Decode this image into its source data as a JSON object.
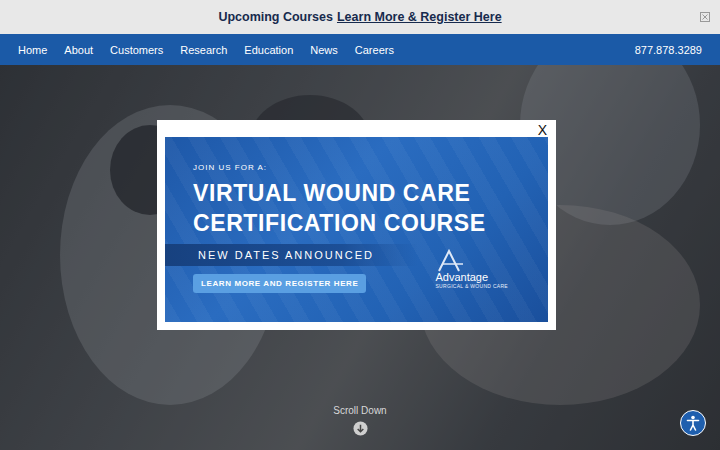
{
  "announcement": {
    "text": "Upcoming Courses",
    "link": "Learn More & Register Here"
  },
  "nav": {
    "items": [
      {
        "label": "Home"
      },
      {
        "label": "About"
      },
      {
        "label": "Customers"
      },
      {
        "label": "Research"
      },
      {
        "label": "Education"
      },
      {
        "label": "News"
      },
      {
        "label": "Careers"
      }
    ],
    "phone": "877.878.3289"
  },
  "hero": {
    "scroll_label": "Scroll Down"
  },
  "modal": {
    "close": "X",
    "kicker": "JOIN US FOR A:",
    "title_lines": [
      "VIRTUAL WOUND CARE",
      "CERTIFICATION COURSE"
    ],
    "band": "NEW DATES ANNOUNCED",
    "button": "LEARN MORE AND REGISTER HERE",
    "logo": {
      "name": "Advantage",
      "tagline": "SURGICAL & WOUND CARE"
    }
  }
}
